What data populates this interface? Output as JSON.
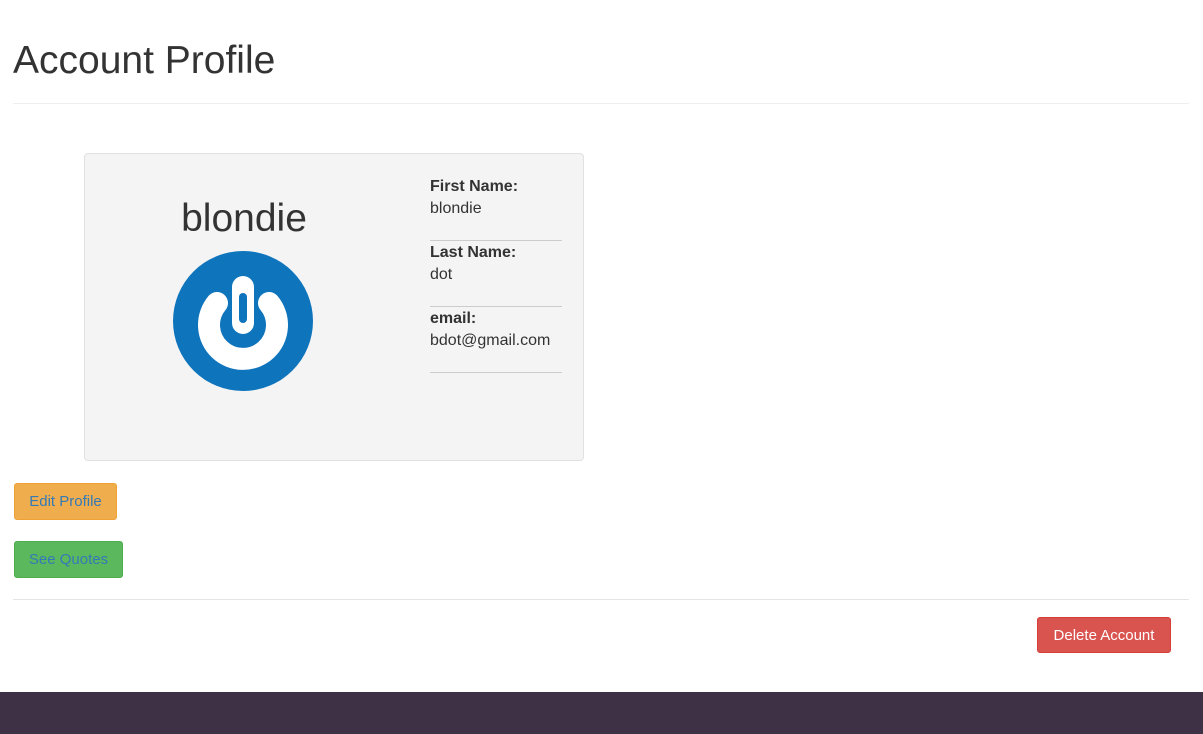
{
  "page": {
    "title": "Account Profile"
  },
  "profile": {
    "username": "blondie",
    "avatar_icon": "power-icon",
    "avatar_color": "#0e74bc",
    "fields": [
      {
        "label": "First Name:",
        "value": "blondie"
      },
      {
        "label": "Last Name:",
        "value": "dot"
      },
      {
        "label": "email:",
        "value": "bdot@gmail.com"
      }
    ]
  },
  "actions": {
    "edit_label": "Edit Profile",
    "quotes_label": "See Quotes",
    "delete_label": "Delete Account"
  },
  "colors": {
    "edit": "#f0ad4e",
    "quotes": "#5cb85c",
    "delete": "#d9534f",
    "footer": "#3f3145"
  }
}
